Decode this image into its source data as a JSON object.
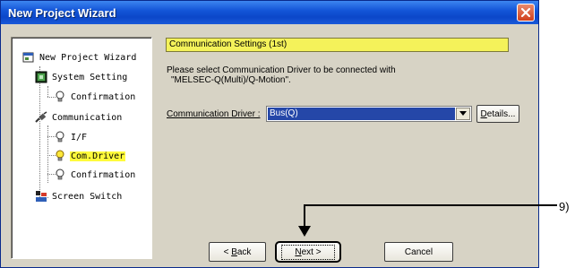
{
  "window": {
    "title": "New Project Wizard"
  },
  "tree": {
    "items": [
      {
        "label": "New Project Wizard",
        "icon": "wizard-icon"
      },
      {
        "label": "System Setting",
        "icon": "system-setting-icon"
      },
      {
        "label": "Confirmation",
        "icon": "bulb-icon"
      },
      {
        "label": "Communication",
        "icon": "connector-icon"
      },
      {
        "label": "I/F",
        "icon": "bulb-icon"
      },
      {
        "label": "Com.Driver",
        "icon": "bulb-icon",
        "highlighted": true
      },
      {
        "label": "Confirmation",
        "icon": "bulb-icon"
      },
      {
        "label": "Screen Switch",
        "icon": "screen-switch-icon"
      }
    ]
  },
  "main": {
    "section_title": "Communication Settings (1st)",
    "instruction_line1": "Please select Communication Driver to be connected with",
    "instruction_line2": "\"MELSEC-Q(Multi)/Q-Motion\".",
    "driver_label": "Communication Driver :",
    "driver_value": "Bus(Q)",
    "details_label_u": "D",
    "details_label_rest": "etails..."
  },
  "buttons": {
    "back_prefix": "< ",
    "back_u": "B",
    "back_rest": "ack",
    "next_u": "N",
    "next_rest": "ext >",
    "cancel": "Cancel"
  },
  "callout": {
    "label": "9)"
  },
  "colors": {
    "titlebar": "#0b47c9",
    "highlight": "#fffb3c",
    "section_bar": "#f4f25a",
    "selection": "#2547a8",
    "dialog_bg": "#d7d3c5"
  }
}
